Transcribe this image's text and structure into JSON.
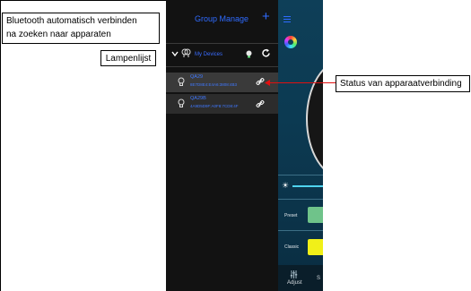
{
  "annotations": {
    "bluetooth_line1": "Bluetooth automatisch verbinden",
    "bluetooth_line2": "na zoeken naar apparaten",
    "lamp_list": "Lampenlijst",
    "connection_status": "Status van apparaatverbinding"
  },
  "app": {
    "header_title": "Group Manage",
    "add_label": "+",
    "group_name": "My Devices",
    "devices": [
      {
        "name": "QA29",
        "address": "8E7D8E4:E4A6:3808:4B3"
      },
      {
        "name": "QA29B",
        "address": "4A9D5D9F:A0F8:7CD8:4F"
      }
    ],
    "adjust_tab_label": "Adjust",
    "second_tab_partial": "S",
    "preset_label": "Preset",
    "classic_label": "Classic"
  },
  "colors": {
    "accent_blue": "#2f6bff",
    "leader_red": "#e01010",
    "preset_green": "#6fc38a",
    "classic_yellow": "#f1f018",
    "slider_cyan": "#4fd3ef"
  }
}
